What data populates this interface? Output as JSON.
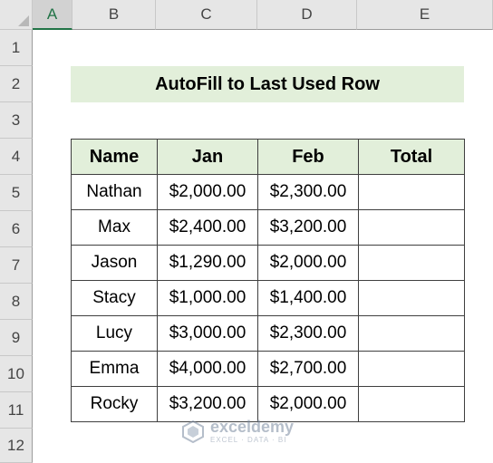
{
  "columns": [
    "A",
    "B",
    "C",
    "D",
    "E"
  ],
  "active_column": "A",
  "rows": [
    "1",
    "2",
    "3",
    "4",
    "5",
    "6",
    "7",
    "8",
    "9",
    "10",
    "11",
    "12"
  ],
  "title": "AutoFill to Last Used Row",
  "table": {
    "headers": [
      "Name",
      "Jan",
      "Feb",
      "Total"
    ],
    "rows": [
      [
        "Nathan",
        "$2,000.00",
        "$2,300.00",
        ""
      ],
      [
        "Max",
        "$2,400.00",
        "$3,200.00",
        ""
      ],
      [
        "Jason",
        "$1,290.00",
        "$2,000.00",
        ""
      ],
      [
        "Stacy",
        "$1,000.00",
        "$1,400.00",
        ""
      ],
      [
        "Lucy",
        "$3,000.00",
        "$2,300.00",
        ""
      ],
      [
        "Emma",
        "$4,000.00",
        "$2,700.00",
        ""
      ],
      [
        "Rocky",
        "$3,200.00",
        "$2,000.00",
        ""
      ]
    ]
  },
  "watermark": {
    "name": "exceldemy",
    "tagline": "EXCEL · DATA · BI"
  },
  "colors": {
    "header_fill": "#e2efda",
    "excel_green": "#217346",
    "grid_header_bg": "#e6e6e6"
  }
}
